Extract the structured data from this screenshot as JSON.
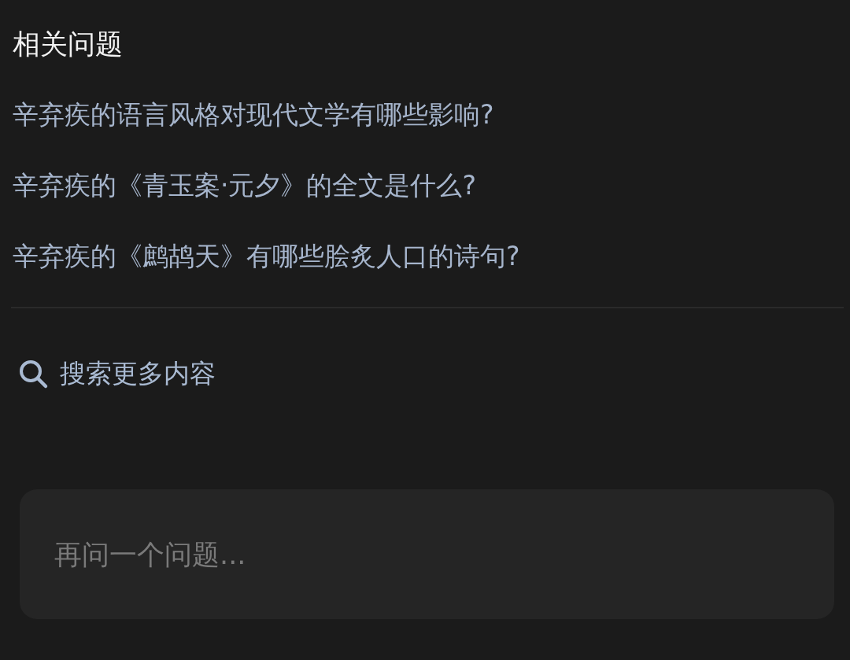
{
  "section_title": "相关问题",
  "questions": [
    "辛弃疾的语言风格对现代文学有哪些影响?",
    "辛弃疾的《青玉案·元夕》的全文是什么?",
    "辛弃疾的《鹧鸪天》有哪些脍炙人口的诗句?"
  ],
  "search_more": {
    "label": "搜索更多内容"
  },
  "ask_input": {
    "placeholder": "再问一个问题..."
  }
}
